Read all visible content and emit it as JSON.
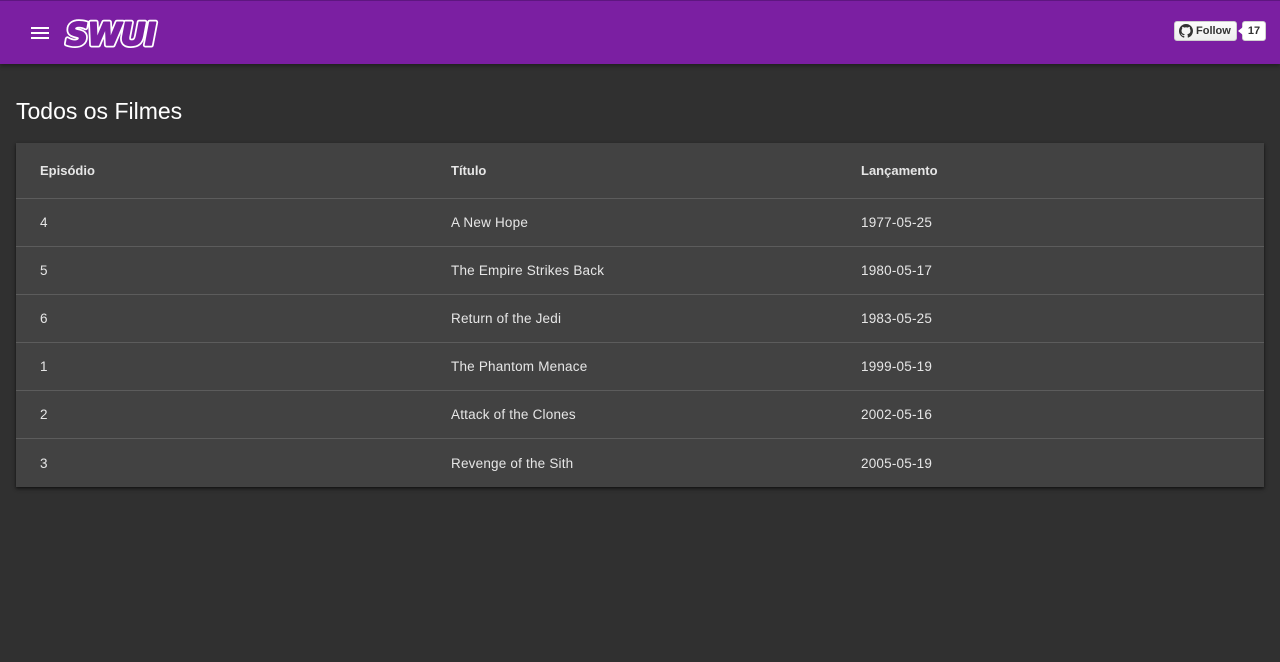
{
  "header": {
    "logo_text": "SWUI",
    "brand_color": "#7b1fa2",
    "menu_icon": "hamburger-menu-icon",
    "github": {
      "icon": "github-icon",
      "follow_label": "Follow",
      "follow_count": "17"
    }
  },
  "page": {
    "title": "Todos os Filmes"
  },
  "table": {
    "headers": [
      "Episódio",
      "Título",
      "Lançamento"
    ],
    "rows": [
      {
        "episode": "4",
        "title": "A New Hope",
        "release": "1977-05-25"
      },
      {
        "episode": "5",
        "title": "The Empire Strikes Back",
        "release": "1980-05-17"
      },
      {
        "episode": "6",
        "title": "Return of the Jedi",
        "release": "1983-05-25"
      },
      {
        "episode": "1",
        "title": "The Phantom Menace",
        "release": "1999-05-19"
      },
      {
        "episode": "2",
        "title": "Attack of the Clones",
        "release": "2002-05-16"
      },
      {
        "episode": "3",
        "title": "Revenge of the Sith",
        "release": "2005-05-19"
      }
    ]
  }
}
